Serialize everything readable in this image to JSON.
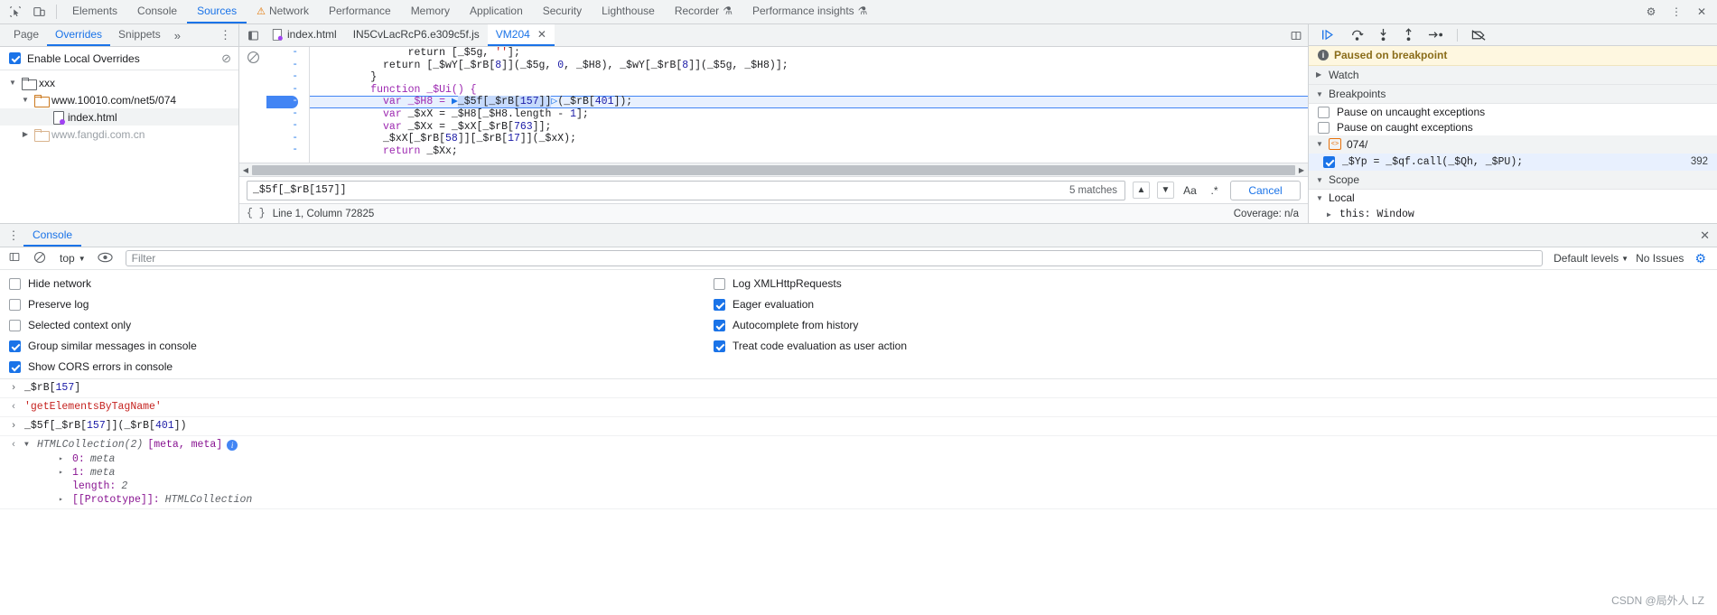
{
  "topbar": {
    "inspect_icon": "inspect-element-icon",
    "device_icon": "device-toolbar-icon",
    "tabs": [
      {
        "label": "Elements",
        "active": false,
        "icon": null
      },
      {
        "label": "Console",
        "active": false,
        "icon": null
      },
      {
        "label": "Sources",
        "active": true,
        "icon": null
      },
      {
        "label": "Network",
        "active": false,
        "icon": "warning-triangle"
      },
      {
        "label": "Performance",
        "active": false,
        "icon": null
      },
      {
        "label": "Memory",
        "active": false,
        "icon": null
      },
      {
        "label": "Application",
        "active": false,
        "icon": null
      },
      {
        "label": "Security",
        "active": false,
        "icon": null
      },
      {
        "label": "Lighthouse",
        "active": false,
        "icon": null
      },
      {
        "label": "Recorder",
        "active": false,
        "icon": "flask"
      },
      {
        "label": "Performance insights",
        "active": false,
        "icon": "flask"
      }
    ],
    "settings_icon": "gear-icon",
    "kebab_icon": "more-options-icon",
    "close_icon": "close-icon"
  },
  "navigator": {
    "tabs": [
      {
        "label": "Page",
        "active": false
      },
      {
        "label": "Overrides",
        "active": true
      },
      {
        "label": "Snippets",
        "active": false
      }
    ],
    "more_label": "»",
    "kebab_icon": "more-options-icon",
    "overrides": {
      "checkbox_label": "Enable Local Overrides",
      "checked": true,
      "clear_icon": "clear-overrides-icon"
    },
    "tree": [
      {
        "label": "xxx",
        "depth": 0,
        "expanded": true,
        "kind": "folder",
        "dim": false,
        "selected": false
      },
      {
        "label": "www.10010.com/net5/074",
        "depth": 1,
        "expanded": true,
        "kind": "folder-orange",
        "dim": false,
        "selected": false
      },
      {
        "label": "index.html",
        "depth": 2,
        "expanded": null,
        "kind": "file",
        "dim": false,
        "selected": true
      },
      {
        "label": "www.fangdi.com.cn",
        "depth": 1,
        "expanded": false,
        "kind": "folder-tan",
        "dim": true,
        "selected": false
      }
    ]
  },
  "editor": {
    "panel_toggle_icon": "show-navigator-icon",
    "tabs": [
      {
        "label": "index.html",
        "active": false,
        "icon": "file-override-icon",
        "closable": false
      },
      {
        "label": "IN5CvLacRcP6.e309c5f.js",
        "active": false,
        "icon": null,
        "closable": false
      },
      {
        "label": "VM204",
        "active": true,
        "icon": null,
        "closable": true
      }
    ],
    "more_icon": "editor-more-icon",
    "blocked_icon": "no-breakpoints-icon",
    "lines": [
      {
        "gutter": "-",
        "highlighted": false,
        "tokens": [
          {
            "t": "              return [_$5g, ",
            "c": "plain"
          },
          {
            "t": "''",
            "c": "str"
          },
          {
            "t": "];",
            "c": "plain"
          }
        ]
      },
      {
        "gutter": "-",
        "highlighted": false,
        "tokens": [
          {
            "t": "          return [_$wY[_$rB[",
            "c": "plain"
          },
          {
            "t": "8",
            "c": "num"
          },
          {
            "t": "]](_$5g, ",
            "c": "plain"
          },
          {
            "t": "0",
            "c": "num"
          },
          {
            "t": ", _$H8), _$wY[_$rB[",
            "c": "plain"
          },
          {
            "t": "8",
            "c": "num"
          },
          {
            "t": "]](_$5g, _$H8)];",
            "c": "plain"
          }
        ]
      },
      {
        "gutter": "-",
        "highlighted": false,
        "tokens": [
          {
            "t": "        }",
            "c": "plain"
          }
        ]
      },
      {
        "gutter": "-",
        "highlighted": false,
        "tokens": [
          {
            "t": "        function _$Ui() {",
            "c": "kw"
          }
        ]
      },
      {
        "gutter": "-",
        "highlighted": true,
        "tokens": [
          {
            "t": "          var _$H8 = ",
            "c": "kw"
          },
          {
            "t": "▶",
            "c": "caret"
          },
          {
            "t": "_$5f[_$rB[",
            "c": "sel"
          },
          {
            "t": "157",
            "c": "sel-num"
          },
          {
            "t": "]]",
            "c": "sel"
          },
          {
            "t": "▷",
            "c": "caret"
          },
          {
            "t": "(_$rB[",
            "c": "plain"
          },
          {
            "t": "401",
            "c": "num"
          },
          {
            "t": "]);",
            "c": "plain"
          }
        ]
      },
      {
        "gutter": "-",
        "highlighted": false,
        "tokens": [
          {
            "t": "          var",
            "c": "kw"
          },
          {
            "t": " _$xX = _$H8[_$H8.length - ",
            "c": "plain"
          },
          {
            "t": "1",
            "c": "num"
          },
          {
            "t": "];",
            "c": "plain"
          }
        ]
      },
      {
        "gutter": "-",
        "highlighted": false,
        "tokens": [
          {
            "t": "          var",
            "c": "kw"
          },
          {
            "t": " _$Xx = _$xX[_$rB[",
            "c": "plain"
          },
          {
            "t": "763",
            "c": "num"
          },
          {
            "t": "]];",
            "c": "plain"
          }
        ]
      },
      {
        "gutter": "-",
        "highlighted": false,
        "tokens": [
          {
            "t": "          _$xX[_$rB[",
            "c": "plain"
          },
          {
            "t": "58",
            "c": "num"
          },
          {
            "t": "]][_$rB[",
            "c": "plain"
          },
          {
            "t": "17",
            "c": "num"
          },
          {
            "t": "]](_$xX);",
            "c": "plain"
          }
        ]
      },
      {
        "gutter": "-",
        "highlighted": false,
        "tokens": [
          {
            "t": "          return",
            "c": "kw"
          },
          {
            "t": " _$Xx;",
            "c": "plain"
          }
        ]
      }
    ],
    "search": {
      "value": "_$5f[_$rB[157]]",
      "matches": "5 matches",
      "prev_icon": "chevron-up-icon",
      "next_icon": "chevron-down-icon",
      "match_case_label": "Aa",
      "regex_label": ".*",
      "cancel_label": "Cancel"
    },
    "status": {
      "pretty_print_icon": "pretty-print-icon",
      "position": "Line 1, Column 72825",
      "coverage": "Coverage: n/a"
    }
  },
  "debugger": {
    "toolbar": [
      {
        "name": "resume-script-execution",
        "glyph": "▷"
      },
      {
        "name": "step-over-next-function-call",
        "glyph": "↷"
      },
      {
        "name": "step-into-next-function-call",
        "glyph": "↓"
      },
      {
        "name": "step-out-of-current-function",
        "glyph": "↑"
      },
      {
        "name": "step",
        "glyph": "→"
      },
      {
        "name": "deactivate-breakpoints",
        "glyph": "⊘"
      }
    ],
    "paused_banner": "Paused on breakpoint",
    "sections": {
      "watch": {
        "label": "Watch",
        "expanded": false
      },
      "breakpoints": {
        "label": "Breakpoints",
        "expanded": true
      },
      "scope": {
        "label": "Scope",
        "expanded": true
      }
    },
    "pause_options": [
      {
        "label": "Pause on uncaught exceptions",
        "checked": false
      },
      {
        "label": "Pause on caught exceptions",
        "checked": false
      }
    ],
    "breakpoint_group": {
      "label": "074/",
      "expanded": true
    },
    "breakpoint_item": {
      "code": "_$Yp = _$qf.call(_$Qh, _$PU);",
      "line": "392",
      "checked": true
    },
    "scope": {
      "local_label": "Local",
      "entries": [
        {
          "label": "this: Window",
          "expanded": false
        }
      ]
    }
  },
  "drawer": {
    "kebab_icon": "drawer-more-icon",
    "tabs": [
      {
        "label": "Console",
        "active": true
      }
    ],
    "close_icon": "close-drawer-icon",
    "toolbar": {
      "sidebar_icon": "console-sidebar-icon",
      "clear_icon": "clear-console-icon",
      "context": "top",
      "eye_icon": "live-expression-icon",
      "filter_placeholder": "Filter",
      "levels_label": "Default levels",
      "issues_label": "No Issues",
      "settings_icon": "console-settings-gear-icon"
    },
    "settings": {
      "left": [
        {
          "label": "Hide network",
          "checked": false
        },
        {
          "label": "Preserve log",
          "checked": false
        },
        {
          "label": "Selected context only",
          "checked": false
        },
        {
          "label": "Group similar messages in console",
          "checked": true
        },
        {
          "label": "Show CORS errors in console",
          "checked": true
        }
      ],
      "right": [
        {
          "label": "Log XMLHttpRequests",
          "checked": false
        },
        {
          "label": "Eager evaluation",
          "checked": true
        },
        {
          "label": "Autocomplete from history",
          "checked": true
        },
        {
          "label": "Treat code evaluation as user action",
          "checked": true
        }
      ]
    },
    "logs": [
      {
        "kind": "input",
        "arrow": "›",
        "tokens": [
          {
            "t": "_$rB[",
            "c": "plain"
          },
          {
            "t": "157",
            "c": "num"
          },
          {
            "t": "]",
            "c": "plain"
          }
        ]
      },
      {
        "kind": "output",
        "arrow": "‹",
        "tokens": [
          {
            "t": "'getElementsByTagName'",
            "c": "str"
          }
        ]
      },
      {
        "kind": "input",
        "arrow": "›",
        "tokens": [
          {
            "t": "_$5f[_$rB[",
            "c": "plain"
          },
          {
            "t": "157",
            "c": "num"
          },
          {
            "t": "]](_$rB[",
            "c": "plain"
          },
          {
            "t": "401",
            "c": "num"
          },
          {
            "t": "])",
            "c": "plain"
          }
        ]
      },
      {
        "kind": "output-object",
        "arrow": "‹",
        "expander": "▼",
        "head": "HTMLCollection(2)",
        "preview": " [meta, meta]",
        "badge": "i",
        "children": [
          {
            "expander": "▸",
            "key": "0:",
            "value": " meta"
          },
          {
            "expander": "▸",
            "key": "1:",
            "value": " meta"
          },
          {
            "expander": "",
            "key": "length:",
            "value": " 2"
          },
          {
            "expander": "▸",
            "key": "[[Prototype]]:",
            "value": " HTMLCollection"
          }
        ]
      }
    ],
    "watermark": "CSDN @局外人 LZ"
  }
}
